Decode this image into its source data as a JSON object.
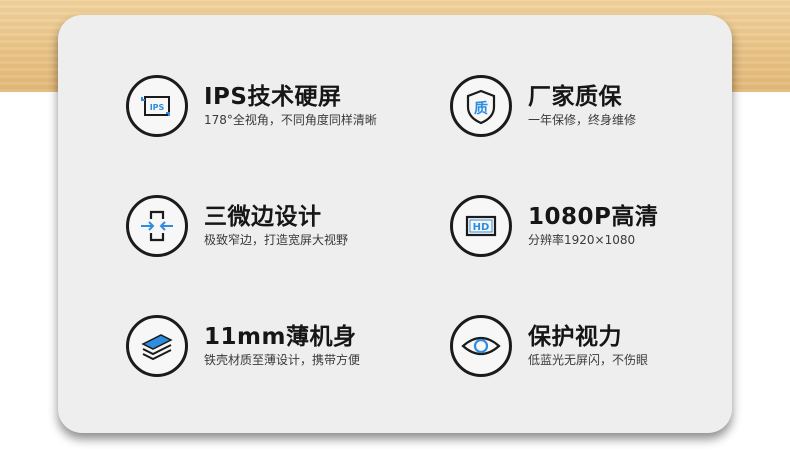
{
  "features": [
    {
      "title": "IPS技术硬屏",
      "desc": "178°全视角，不同角度同样清晰",
      "icon": "ips-screen-icon"
    },
    {
      "title": "厂家质保",
      "desc": "一年保修，终身维修",
      "icon": "quality-shield-icon"
    },
    {
      "title": "三微边设计",
      "desc": "极致窄边，打造宽屏大视野",
      "icon": "narrow-bezel-icon"
    },
    {
      "title": "1080P高清",
      "desc": "分辨率1920×1080",
      "icon": "hd-icon"
    },
    {
      "title": "11mm薄机身",
      "desc": "铁壳材质至薄设计，携带方便",
      "icon": "thin-layers-icon"
    },
    {
      "title": "保护视力",
      "desc": "低蓝光无屏闪，不伤眼",
      "icon": "eye-icon"
    }
  ],
  "icon_labels": {
    "ips": "IPS",
    "quality": "质",
    "hd": "HD"
  },
  "colors": {
    "accent": "#2e8de0",
    "ink": "#1b1b1b",
    "card": "#eeeeef"
  }
}
